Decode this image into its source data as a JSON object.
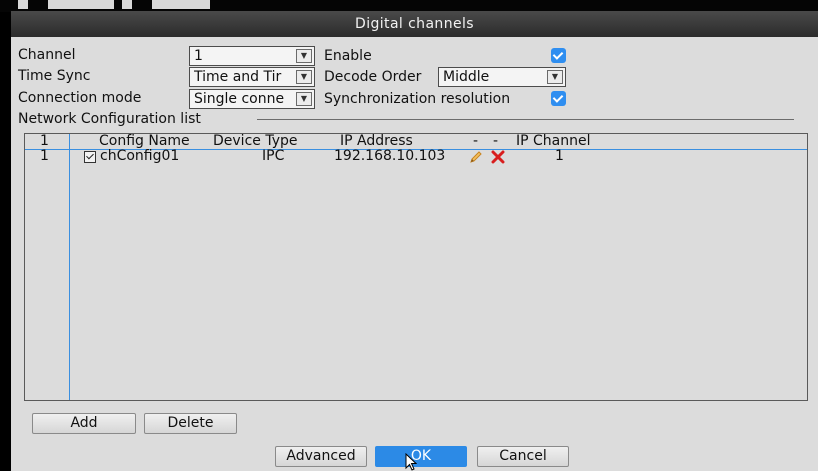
{
  "window": {
    "title": "Digital channels"
  },
  "fields": {
    "channel_label": "Channel",
    "channel_value": "1",
    "enable_label": "Enable",
    "time_sync_label": "Time Sync",
    "time_sync_value": "Time and Tir",
    "decode_order_label": "Decode Order",
    "decode_order_value": "Middle",
    "connection_mode_label": "Connection mode",
    "connection_mode_value": "Single conne",
    "sync_resolution_label": "Synchronization resolution"
  },
  "network_list": {
    "title": "Network Configuration list",
    "headers": {
      "index": "1",
      "config_name": "Config Name",
      "device_type": "Device Type",
      "ip_address": "IP Address",
      "col_edit": "-",
      "col_delete": "-",
      "ip_channel": "IP Channel"
    },
    "rows": [
      {
        "index": "1",
        "config_name": "chConfig01",
        "device_type": "IPC",
        "ip_address": "192.168.10.103",
        "ip_channel": "1"
      }
    ]
  },
  "buttons": {
    "add": "Add",
    "delete": "Delete",
    "advanced": "Advanced",
    "ok": "OK",
    "cancel": "Cancel"
  },
  "colors": {
    "accent": "#2c8ae6",
    "title_bar": "#333333",
    "delete_icon": "#d81e1e",
    "edit_icon": "#e8a33a"
  },
  "icons": {
    "edit": "pencil-icon",
    "delete": "delete-x-icon",
    "dropdown": "chevron-down-icon",
    "checkbox": "checkbox-checked-icon"
  }
}
